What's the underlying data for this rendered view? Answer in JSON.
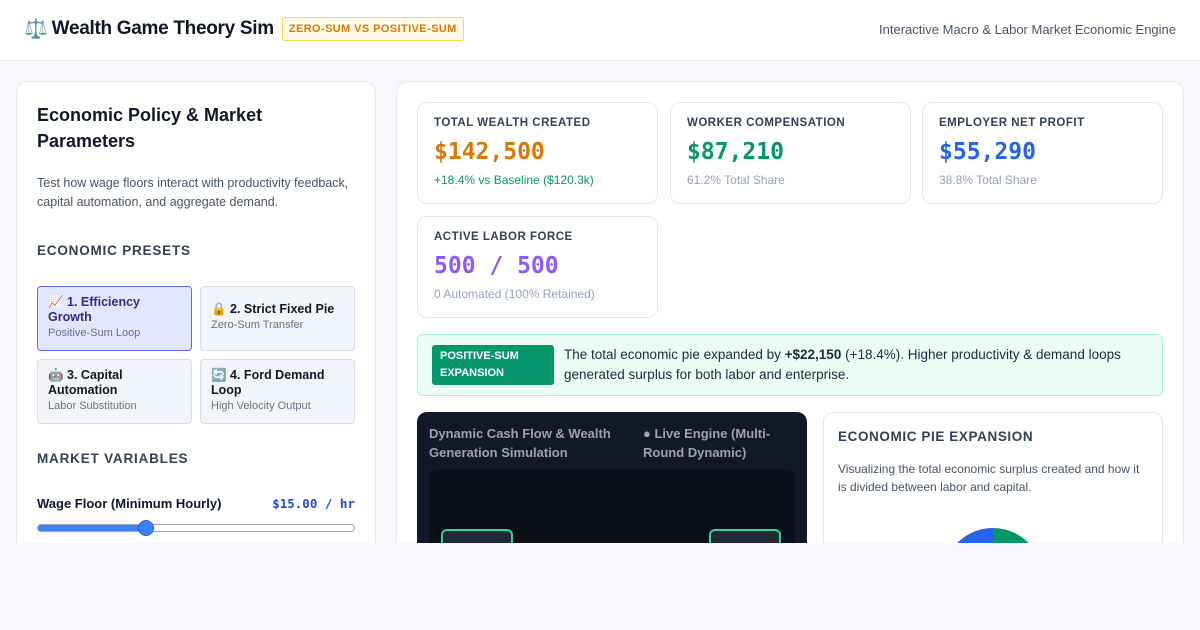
{
  "header": {
    "icon": "⚖️",
    "title": "Wealth Game Theory Sim",
    "badge": "ZERO-SUM VS POSITIVE-SUM",
    "subtitle": "Interactive Macro & Labor Market Economic Engine"
  },
  "sidebar": {
    "title": "Economic Policy & Market Parameters",
    "description": "Test how wage floors interact with productivity feedback, capital automation, and aggregate demand.",
    "presets_label": "ECONOMIC PRESETS",
    "presets": [
      {
        "name": "📈 1. Efficiency Growth",
        "sub": "Positive-Sum Loop",
        "active": true
      },
      {
        "name": "🔒 2. Strict Fixed Pie",
        "sub": "Zero-Sum Transfer",
        "active": false
      },
      {
        "name": "🤖 3. Capital Automation",
        "sub": "Labor Substitution",
        "active": false
      },
      {
        "name": "🔄 4. Ford Demand Loop",
        "sub": "High Velocity Output",
        "active": false
      }
    ],
    "variables_label": "MARKET VARIABLES",
    "wage_floor": {
      "label": "Wage Floor (Minimum Hourly)",
      "value": "$15.00 / hr",
      "slider_fraction": 0.34
    }
  },
  "metrics": [
    {
      "label": "TOTAL WEALTH CREATED",
      "value": "$142,500",
      "sub": "+18.4% vs Baseline ($120.3k)",
      "color": "#d97706",
      "sub_color": "#059669"
    },
    {
      "label": "WORKER COMPENSATION",
      "value": "$87,210",
      "sub": "61.2% Total Share",
      "color": "#059669",
      "sub_color": "#94a3b8"
    },
    {
      "label": "EMPLOYER NET PROFIT",
      "value": "$55,290",
      "sub": "38.8% Total Share",
      "color": "#2563eb",
      "sub_color": "#94a3b8"
    },
    {
      "label": "ACTIVE LABOR FORCE",
      "value": "500 / 500",
      "sub": "0 Automated (100% Retained)",
      "color": "#8b5cf6",
      "sub_color": "#94a3b8"
    }
  ],
  "banner": {
    "badge": "POSITIVE-SUM EXPANSION",
    "text_before": "The total economic pie expanded by ",
    "text_bold": "+$22,150",
    "text_after": " (+18.4%). Higher productivity & demand loops generated surplus for both labor and enterprise."
  },
  "simulation": {
    "title": "Dynamic Cash Flow & Wealth Generation Simulation",
    "status": "● Live Engine (Multi-Round Dynamic)"
  },
  "pie": {
    "title": "ECONOMIC PIE EXPANSION",
    "description": "Visualizing the total economic surplus created and how it is divided between labor and capital.",
    "worker_share": 61.2,
    "employer_share": 38.8,
    "worker_color": "#059669",
    "employer_color": "#2563eb"
  }
}
